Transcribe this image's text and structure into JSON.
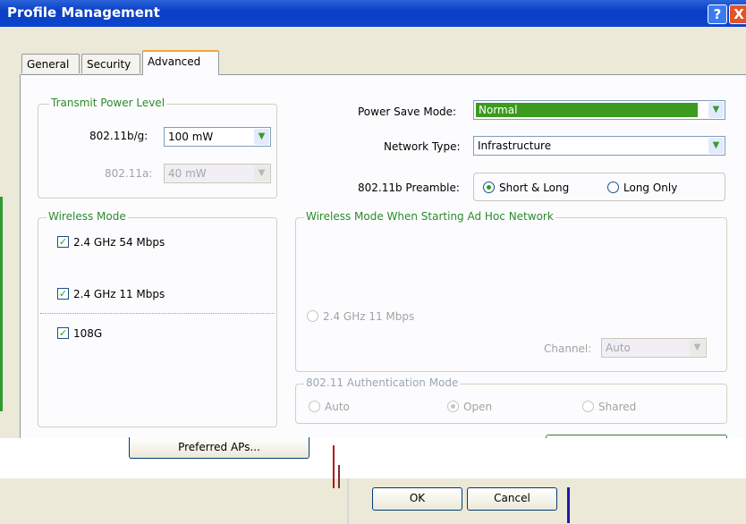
{
  "window": {
    "title": "Profile Management",
    "help_label": "?",
    "close_label": "X"
  },
  "tabs": [
    {
      "label": "General",
      "active": false
    },
    {
      "label": "Security",
      "active": false
    },
    {
      "label": "Advanced",
      "active": true
    }
  ],
  "transmit_power": {
    "group_label": "Transmit Power Level",
    "b_g_label": "802.11b/g:",
    "b_g_value": "100 mW",
    "a_label": "802.11a:",
    "a_value": "40 mW"
  },
  "power_save": {
    "label": "Power Save Mode:",
    "value": "Normal"
  },
  "network_type": {
    "label": "Network Type:",
    "value": "Infrastructure"
  },
  "preamble": {
    "label": "802.11b Preamble:",
    "options": [
      "Short & Long",
      "Long Only"
    ],
    "selected": "Short & Long"
  },
  "wireless_mode": {
    "group_label": "Wireless Mode",
    "items": [
      {
        "label": "2.4 GHz 54 Mbps",
        "checked": true
      },
      {
        "label": "2.4 GHz 11 Mbps",
        "checked": true
      },
      {
        "label": "108G",
        "checked": true
      }
    ]
  },
  "adhoc_mode": {
    "group_label": "Wireless Mode When Starting Ad Hoc Network",
    "option_label": "2.4 GHz 11 Mbps",
    "channel_label": "Channel:",
    "channel_value": "Auto"
  },
  "auth_mode": {
    "group_label": "802.11 Authentication Mode",
    "options": [
      "Auto",
      "Open",
      "Shared"
    ],
    "selected": "Open"
  },
  "buttons": {
    "preferred_aps": "Preferred APs...",
    "ok": "OK",
    "cancel": "Cancel"
  },
  "colors": {
    "titlebar": "#0a3fc4",
    "accent_green": "#2c8a2c",
    "selected_highlight": "#3c9a1e"
  },
  "icons": [
    "help-icon",
    "close-icon",
    "chevron-down-icon",
    "checkmark-icon"
  ]
}
